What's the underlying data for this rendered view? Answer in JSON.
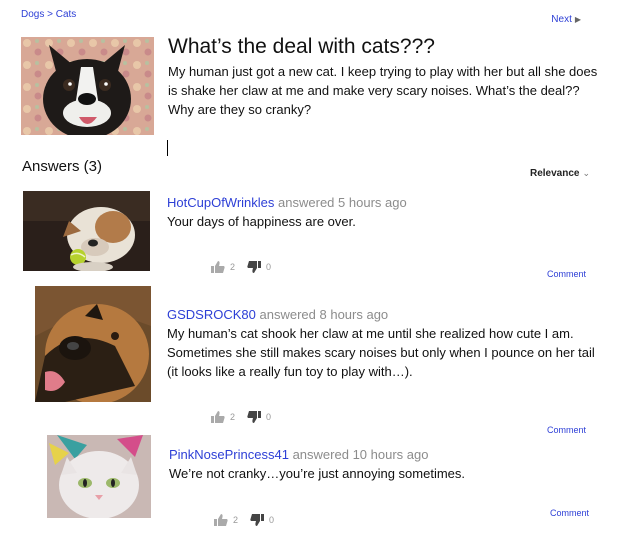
{
  "breadcrumb": "Dogs > Cats",
  "next_label": "Next",
  "question": {
    "title": "What’s the deal with cats???",
    "body": "My human just got a new cat. I keep trying to play with her but all she does is shake her claw at me and make very scary noises. What’s the deal?? Why are they so cranky?"
  },
  "answers_heading": "Answers (3)",
  "sort_label": "Relevance",
  "answers": [
    {
      "user": "HotCupOfWrinkles",
      "answered_word": "answered",
      "time": "5 hours ago",
      "text": "Your days of happiness are over.",
      "likes": "2",
      "dislikes": "0",
      "comment_label": "Comment"
    },
    {
      "user": "GSDSROCK80",
      "answered_word": "answered",
      "time": "8 hours ago",
      "text": "My human’s cat shook her claw at me until she realized how cute I am. Sometimes she still makes scary noises but only when I pounce on her tail (it looks like a really fun toy to play with…).",
      "likes": "2",
      "dislikes": "0",
      "comment_label": "Comment"
    },
    {
      "user": "PinkNosePrincess41",
      "answered_word": "answered",
      "time": "10 hours ago",
      "text": "We’re not cranky…you’re just annoying sometimes.",
      "likes": "2",
      "dislikes": "0",
      "comment_label": "Comment"
    }
  ]
}
